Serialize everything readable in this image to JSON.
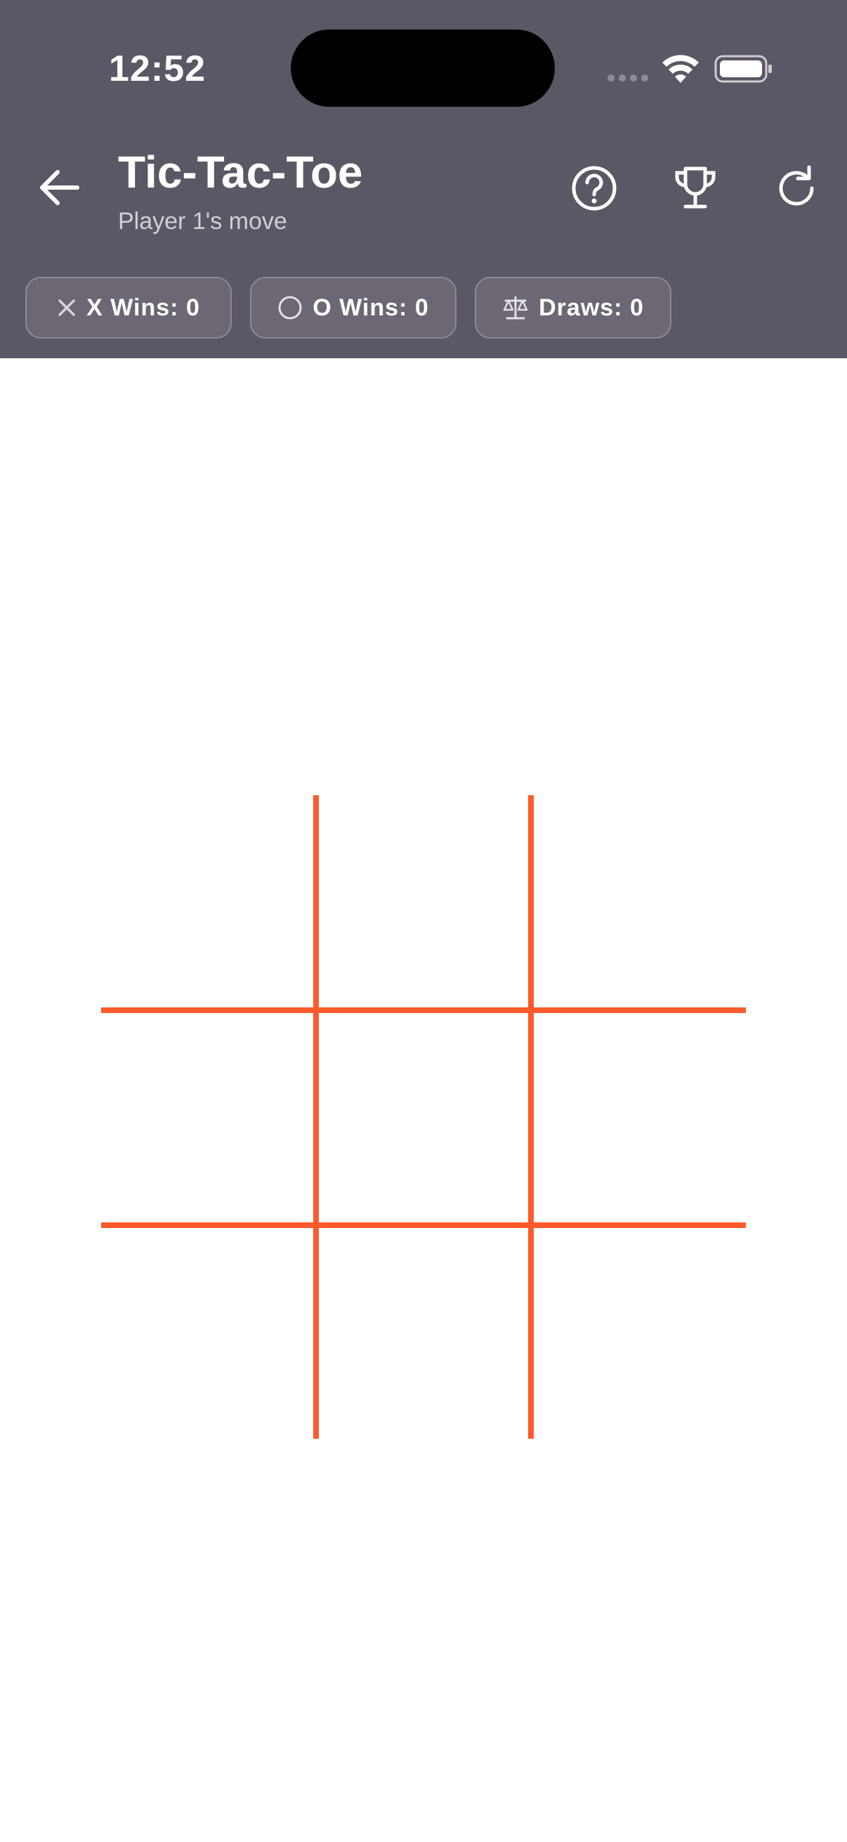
{
  "status_bar": {
    "time": "12:52"
  },
  "header": {
    "title": "Tic-Tac-Toe",
    "subtitle": "Player 1's move",
    "actions": [
      "back-icon",
      "help-icon",
      "trophy-icon",
      "refresh-icon"
    ]
  },
  "scores": {
    "x_label": "X Wins: 0",
    "o_label": "O Wins: 0",
    "draws_label": "Draws: 0"
  },
  "board": {
    "cells": [
      "",
      "",
      "",
      "",
      "",
      "",
      "",
      "",
      ""
    ]
  },
  "colors": {
    "header_bg": "#5c5764",
    "grid_line": "#ff5a2b",
    "chip_bg": "#6c6773",
    "page_bg": "#ffffff"
  }
}
